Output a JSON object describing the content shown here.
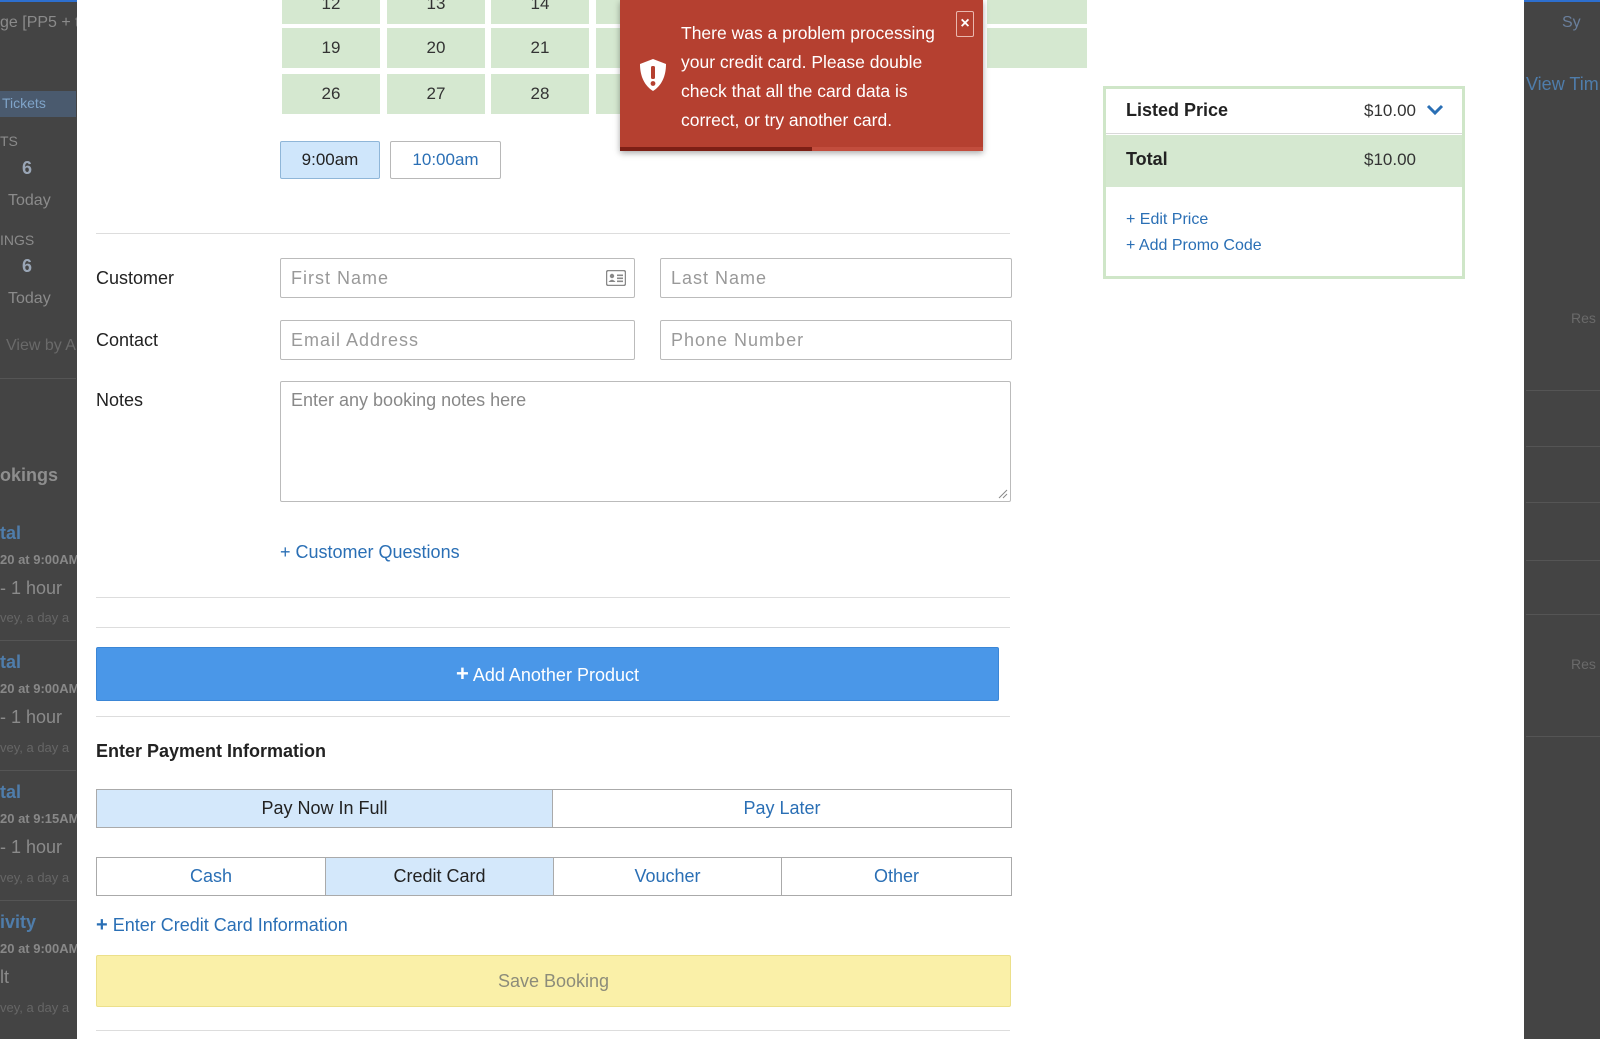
{
  "background": {
    "fragments_left": [
      "ge [PP5 + t",
      "Tickets",
      "TS",
      "6",
      "Today",
      "INGS",
      "6",
      "Today",
      "View by A",
      "okings",
      "tal",
      "20 at 9:00AM",
      "- 1 hour",
      "vey, a day a",
      "tal",
      "20 at 9:00AM",
      "- 1 hour",
      "vey, a day a",
      "tal",
      "20 at 9:15AM",
      "- 1 hour",
      "vey, a day a",
      "ivity",
      "20 at 9:00AM",
      "lt",
      "vey, a day a"
    ],
    "fragments_right": [
      "Sy",
      "View Tim",
      "Res",
      "Res"
    ]
  },
  "calendar": {
    "row_a": [
      "12",
      "13",
      "14"
    ],
    "row_b": [
      "19",
      "20",
      "21"
    ],
    "row_c": [
      "26",
      "27",
      "28"
    ]
  },
  "times": {
    "selected": "9:00am",
    "other": "10:00am"
  },
  "form": {
    "customer_label": "Customer",
    "contact_label": "Contact",
    "notes_label": "Notes",
    "first_name_placeholder": "First Name",
    "last_name_placeholder": "Last Name",
    "email_placeholder": "Email Address",
    "phone_placeholder": "Phone Number",
    "notes_placeholder": "Enter any booking notes here",
    "customer_questions_link": "+ Customer Questions"
  },
  "add_product_label": "Add Another Product",
  "payment": {
    "title": "Enter Payment Information",
    "plan_options": [
      "Pay Now In Full",
      "Pay Later"
    ],
    "plan_selected": "Pay Now In Full",
    "methods": [
      "Cash",
      "Credit Card",
      "Voucher",
      "Other"
    ],
    "method_selected": "Credit Card",
    "enter_card_link": "Enter Credit Card Information",
    "save_label": "Save Booking"
  },
  "alert": {
    "message": "There was a problem processing your credit card. Please double check that all the card data is correct, or try another card.",
    "close_label": "×",
    "progress": 0.53,
    "icon": "shield-alert-icon"
  },
  "price_panel": {
    "listed_price_label": "Listed Price",
    "listed_price_value": "$10.00",
    "total_label": "Total",
    "total_value": "$10.00",
    "edit_price_link": "+ Edit Price",
    "add_promo_link": "+ Add Promo Code"
  },
  "colors": {
    "primary": "#4a97e8",
    "alert": "#b54030",
    "success_bg": "#d5e8d0",
    "save_bg": "#faf0a8",
    "link": "#2a6fb5"
  }
}
